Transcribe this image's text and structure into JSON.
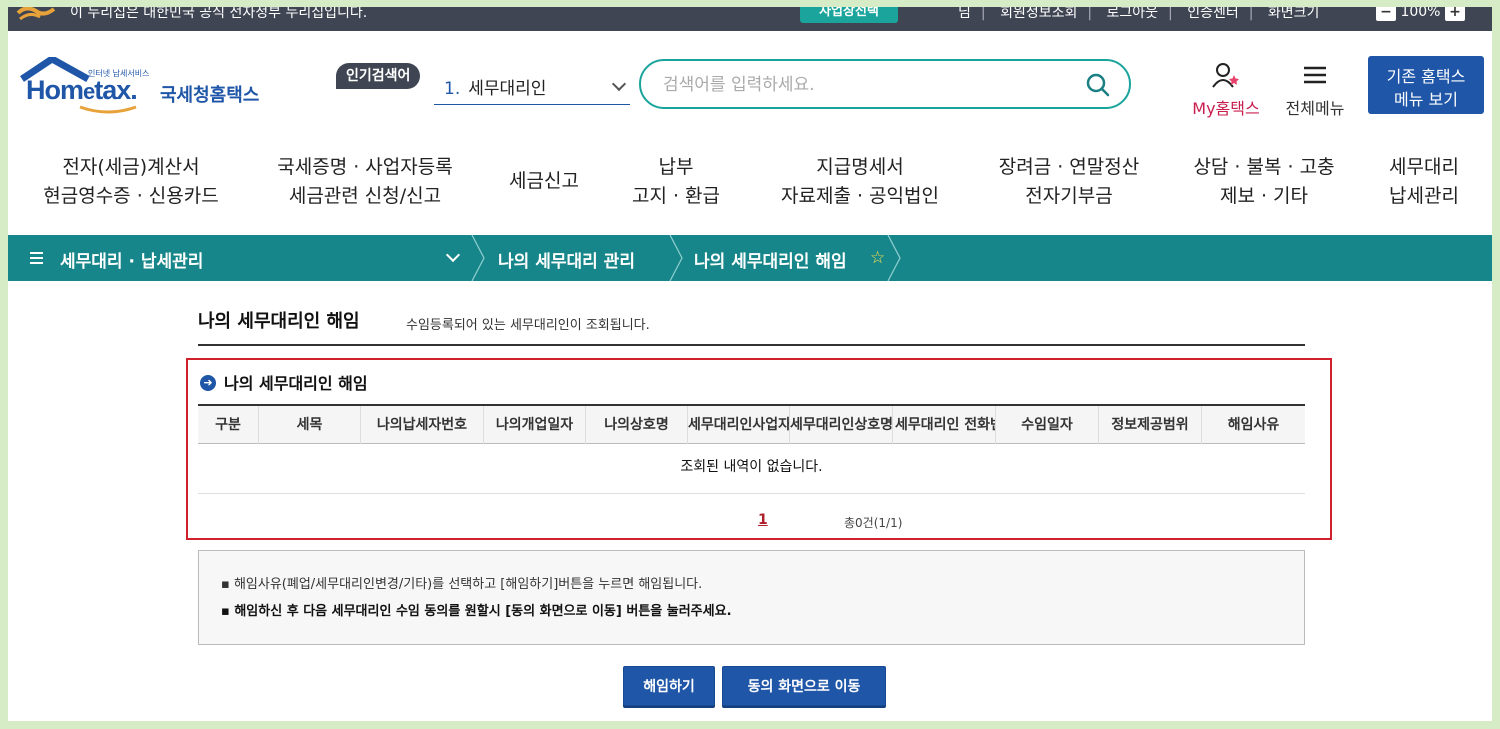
{
  "topbar": {
    "notice": "이 누리집은 대한민국 공식 전자정부 누리집입니다.",
    "biz_button": "사업장선택",
    "links": [
      "님",
      "회원정보조회",
      "로그아웃",
      "인증센터",
      "화면크기"
    ],
    "zoom_level": "100%",
    "zoom_minus": "−",
    "zoom_plus": "+"
  },
  "header": {
    "logo_sub": "인터넷 납세서비스",
    "logo_home": "Hom",
    "logo_e": "e",
    "logo_tax": "tax.",
    "logo_name": "국세청홈택스",
    "popular_label": "인기검색어",
    "popular_rank": "1.",
    "popular_term": "세무대리인",
    "search_placeholder": "검색어를 입력하세요.",
    "my_hometax": "My홈택스",
    "all_menu": "전체메뉴",
    "old_menu_line1": "기존 홈택스",
    "old_menu_line2": "메뉴 보기"
  },
  "gnb": [
    {
      "line1": "전자(세금)계산서",
      "line2": "현금영수증 · 신용카드"
    },
    {
      "line1": "국세증명 · 사업자등록",
      "line2": "세금관련 신청/신고"
    },
    {
      "line1": "세금신고",
      "line2": ""
    },
    {
      "line1": "납부",
      "line2": "고지 · 환급"
    },
    {
      "line1": "지급명세서",
      "line2": "자료제출 · 공익법인"
    },
    {
      "line1": "장려금 · 연말정산",
      "line2": "전자기부금"
    },
    {
      "line1": "상담 · 불복 · 고충",
      "line2": "제보 · 기타"
    },
    {
      "line1": "세무대리",
      "line2": "납세관리"
    }
  ],
  "breadcrumb": {
    "level1": "세무대리 · 납세관리",
    "level2": "나의 세무대리 관리",
    "level3": "나의 세무대리인 해임"
  },
  "content": {
    "title": "나의 세무대리인 해임",
    "description": "수임등록되어 있는 세무대리인이 조회됩니다.",
    "section_title": "나의 세무대리인 해임",
    "columns": [
      "구분",
      "세목",
      "나의납세자번호",
      "나의개업일자",
      "나의상호명",
      "세무대리인사업자번호",
      "세무대리인상호명",
      "세무대리인 전화번호",
      "수임일자",
      "정보제공범위",
      "해임사유"
    ],
    "empty_message": "조회된 내역이 없습니다.",
    "page_number": "1",
    "total_text": "총0건(1/1)",
    "info_line1": "▪ 해임사유(폐업/세무대리인변경/기타)를 선택하고 [해임하기]버튼을 누르면 해임됩니다.",
    "info_line2": "▪ 해임하신 후 다음 세무대리인 수임 동의를 원할시 [동의 화면으로 이동] 버튼을 눌러주세요.",
    "dismiss_button": "해임하기",
    "consent_button": "동의 화면으로 이동"
  },
  "colors": {
    "brand_blue": "#1f56a8",
    "teal": "#17868a",
    "highlight_red": "#d0202b",
    "topbar_dark": "#3f4552"
  }
}
